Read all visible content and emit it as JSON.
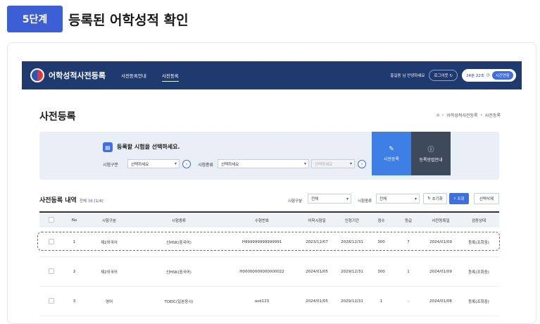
{
  "step": {
    "badge": "5단계",
    "title": "등록된 어학성적 확인"
  },
  "topbar": {
    "logo_text": "어학성적사전등록",
    "nav": [
      "사전등록안내",
      "사전등록"
    ],
    "user_text": "홍길동 님 안녕하세요",
    "logout_label": "로그아웃",
    "timer": "24분 22초",
    "extend_label": "시간연장"
  },
  "page": {
    "title": "사전등록",
    "breadcrumb": [
      "어학성적사전등록",
      "사전등록"
    ]
  },
  "search": {
    "heading": "등록할 시험을 선택하세요.",
    "label_type": "시험구분",
    "label_kind": "시험종류",
    "select_type": "선택하세요",
    "select_kind": "선택하세요",
    "select_disabled": "선택하세요",
    "tile_register": "사전등록",
    "tile_guide": "등록방법안내"
  },
  "list": {
    "title": "사전등록 내역",
    "count_prefix": "전체",
    "count_num": "38",
    "count_pages": "[1/4]",
    "filter_type_label": "시험구분",
    "filter_type_value": "전체",
    "filter_kind_label": "시험종류",
    "filter_kind_value": "전체",
    "reset_label": "초기화",
    "search_label": "조회",
    "delete_label": "선택삭제"
  },
  "table": {
    "headers": [
      "No",
      "시험구분",
      "시험종류",
      "수험번호",
      "어학시험일",
      "인정기간",
      "점수",
      "등급",
      "사전등록일",
      "검증상태"
    ],
    "rows": [
      [
        "1",
        "제2외국어",
        "신HSK(중국어)",
        "H999999999999991",
        "2023/12/07",
        "2028/12/31",
        "300",
        "7",
        "2024/01/09",
        "등록(조회중)"
      ],
      [
        "2",
        "제2외국어",
        "신HSK(중국어)",
        "H00000000000000022",
        "2024/01/05",
        "2029/12/31",
        "300",
        "1",
        "2024/01/09",
        "등록(조회중)"
      ],
      [
        "3",
        "영어",
        "TOEIC(일본응시)",
        "asd123",
        "2024/01/05",
        "2029/12/31",
        "1",
        "-",
        "2024/01/08",
        "등록(조회중)"
      ]
    ]
  },
  "colors": {
    "accent": "#3d5fd6",
    "topbar": "#1e3a6e",
    "highlight": "#e03c3c"
  }
}
